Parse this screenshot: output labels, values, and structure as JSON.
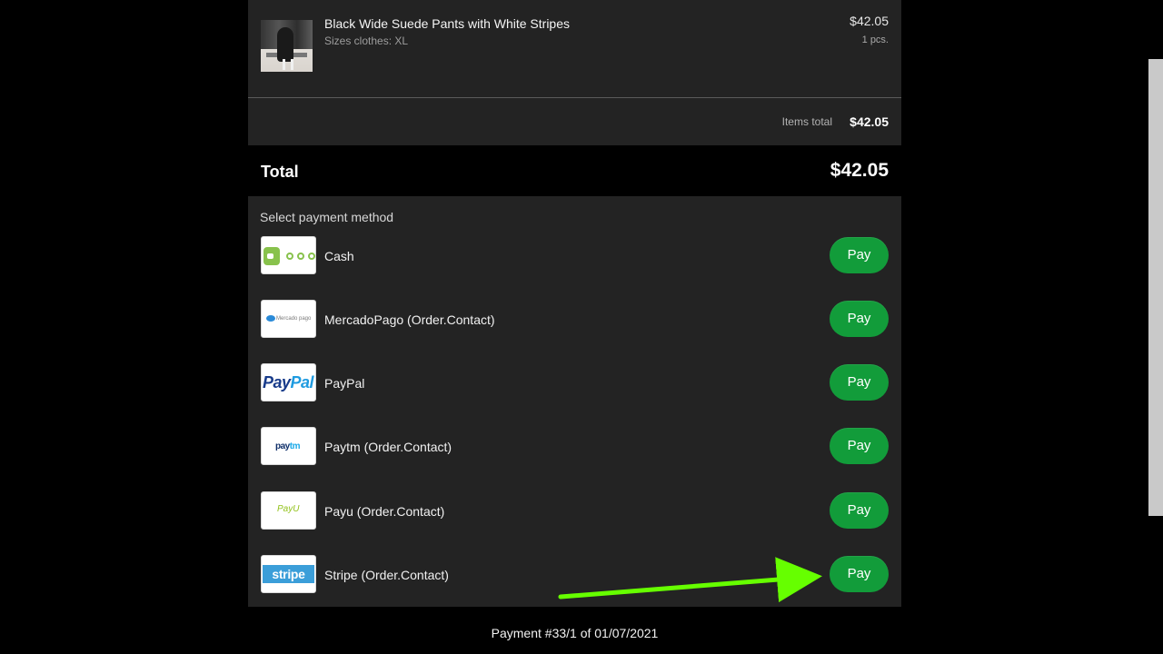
{
  "product": {
    "name": "Black Wide Suede Pants with White Stripes",
    "size": "Sizes clothes: XL",
    "price": "$42.05",
    "quantity": "1 pcs."
  },
  "summary": {
    "items_total_label": "Items total",
    "items_total_value": "$42.05",
    "total_label": "Total",
    "total_value": "$42.05"
  },
  "payment": {
    "title": "Select payment method",
    "methods": [
      {
        "name": "Cash",
        "logo": "cash-logo-icon",
        "button": "Pay"
      },
      {
        "name": "MercadoPago (Order.Contact)",
        "logo": "mercado-pago-logo",
        "logo_text": "Mercado pago",
        "button": "Pay"
      },
      {
        "name": "PayPal",
        "logo": "paypal-logo",
        "logo_word_1": "Pay",
        "logo_word_2": "Pal",
        "button": "Pay"
      },
      {
        "name": "Paytm (Order.Contact)",
        "logo": "paytm-logo",
        "logo_word_1": "pay",
        "logo_word_2": "tm",
        "button": "Pay"
      },
      {
        "name": "Payu (Order.Contact)",
        "logo": "payu-logo",
        "logo_text": "PayU",
        "button": "Pay"
      },
      {
        "name": "Stripe (Order.Contact)",
        "logo": "stripe-logo",
        "logo_text": "stripe",
        "button": "Pay"
      }
    ]
  },
  "footer": {
    "payment_text": "Payment #33/1 of 01/07/2021"
  },
  "colors": {
    "background": "#000000",
    "panel": "#232323",
    "button": "#129c3a",
    "arrow": "#66ff00"
  }
}
